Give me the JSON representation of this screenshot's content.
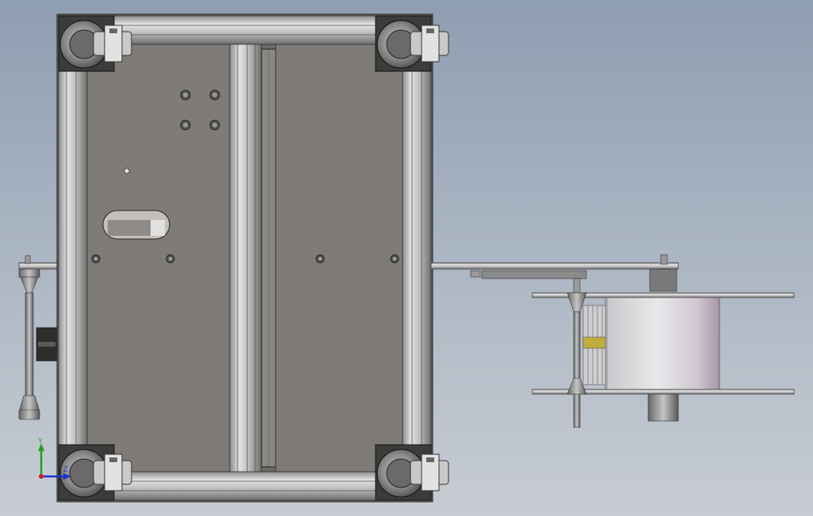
{
  "view": {
    "type": "cad-3d-viewport",
    "background_top": "#8e9db1",
    "background_bottom": "#c7ccd3"
  },
  "model": {
    "frame_color": "#c9c9c9",
    "panel_color": "#7f7b76",
    "caster_color": "#b5b5b5",
    "drum_color": "#d9d9dc"
  },
  "triad": {
    "y_label": "Y",
    "z_label": "Z",
    "x_color": "#d02020",
    "y_color": "#20a020",
    "z_color": "#2030d0"
  }
}
